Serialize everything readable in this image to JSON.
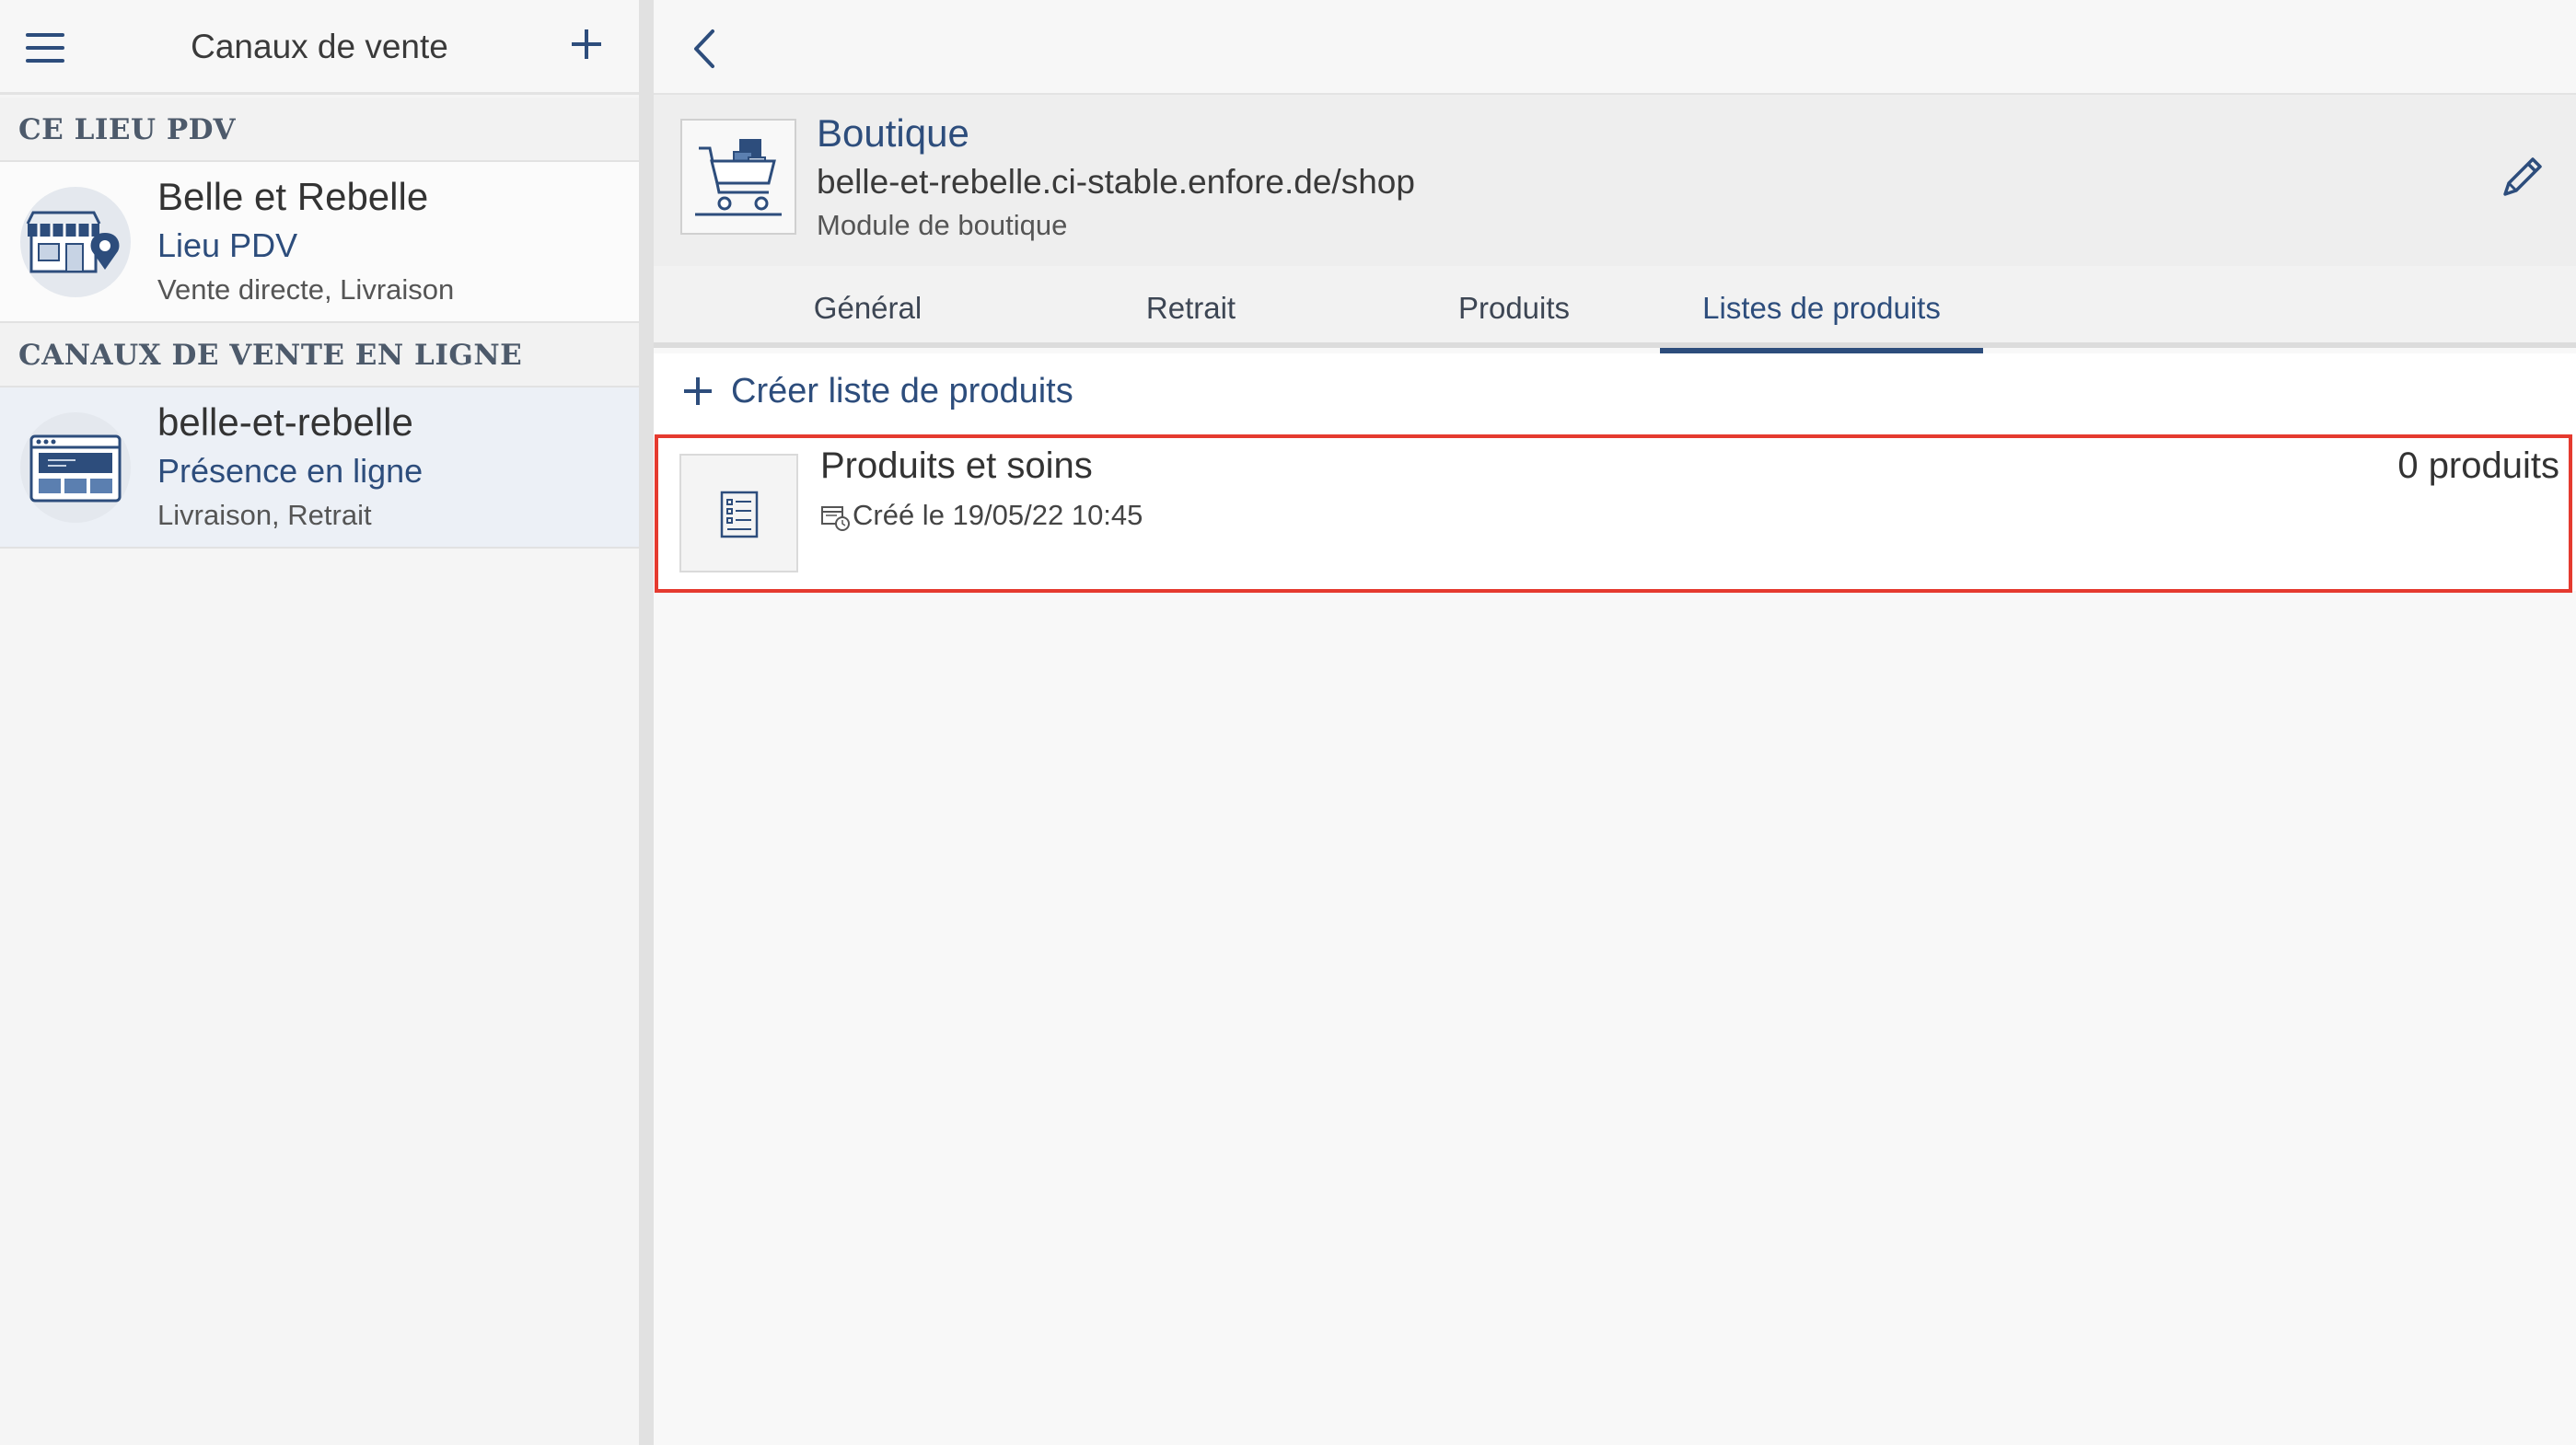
{
  "sidebar": {
    "title": "Canaux de vente",
    "sections": [
      {
        "heading": "CE LIEU PDV",
        "items": [
          {
            "name": "Belle et Rebelle",
            "type": "Lieu PDV",
            "details": "Vente directe, Livraison",
            "icon": "store-location-icon"
          }
        ]
      },
      {
        "heading": "CANAUX DE VENTE EN LIGNE",
        "items": [
          {
            "name": "belle-et-rebelle",
            "type": "Présence en ligne",
            "details": "Livraison, Retrait",
            "icon": "website-icon"
          }
        ]
      }
    ]
  },
  "main": {
    "shop": {
      "title": "Boutique",
      "url": "belle-et-rebelle.ci-stable.enfore.de/shop",
      "module": "Module de boutique",
      "icon": "shopping-cart-icon"
    },
    "tabs": [
      {
        "label": "Général",
        "active": false
      },
      {
        "label": "Retrait",
        "active": false
      },
      {
        "label": "Produits",
        "active": false
      },
      {
        "label": "Listes de produits",
        "active": true
      }
    ],
    "create_label": "Créer liste de produits",
    "product_lists": [
      {
        "name": "Produits et soins",
        "created": "Créé le 19/05/22 10:45",
        "count": "0 produits",
        "icon": "list-document-icon"
      }
    ]
  },
  "colors": {
    "accent": "#2d4d7c",
    "highlight": "#e53a2f",
    "selected_bg": "#ecf0f6"
  }
}
